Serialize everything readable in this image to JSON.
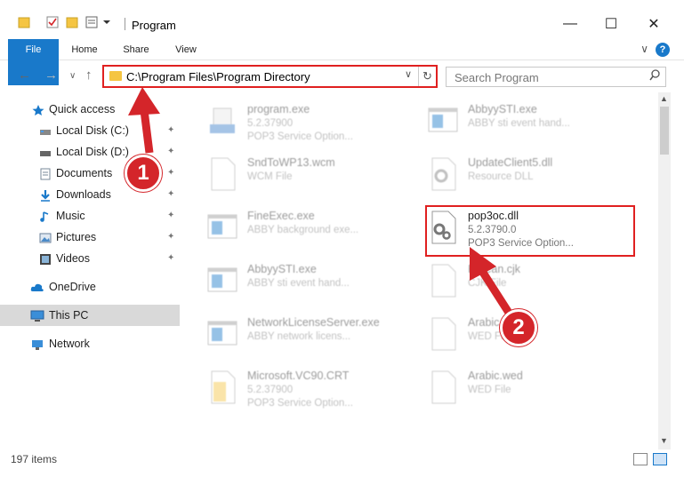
{
  "window": {
    "title": "Program",
    "minimize": "—",
    "maximize": "☐",
    "close": "✕"
  },
  "ribbon": {
    "tabs": [
      "File",
      "Home",
      "Share",
      "View"
    ],
    "help": "?",
    "collapse": "∨"
  },
  "address": {
    "path": "C:\\Program Files\\Program Directory",
    "dropdown": "∨",
    "refresh": "↻"
  },
  "search": {
    "placeholder": "Search Program",
    "icon": "search-icon"
  },
  "nav": {
    "back": "←",
    "forward": "→",
    "recent": "∨",
    "up": "↑"
  },
  "sidebar": {
    "items": [
      {
        "label": "Quick access",
        "icon": "star-icon",
        "pinned": false
      },
      {
        "label": "Local Disk (C:)",
        "icon": "drive-icon",
        "pinned": true
      },
      {
        "label": "Local Disk (D:)",
        "icon": "drive-icon",
        "pinned": true
      },
      {
        "label": "Documents",
        "icon": "documents-icon",
        "pinned": true
      },
      {
        "label": "Downloads",
        "icon": "download-icon",
        "pinned": true
      },
      {
        "label": "Music",
        "icon": "music-icon",
        "pinned": true
      },
      {
        "label": "Pictures",
        "icon": "pictures-icon",
        "pinned": true
      },
      {
        "label": "Videos",
        "icon": "videos-icon",
        "pinned": true
      },
      {
        "label": "OneDrive",
        "icon": "cloud-icon",
        "pinned": false
      },
      {
        "label": "This PC",
        "icon": "computer-icon",
        "pinned": false
      },
      {
        "label": "Network",
        "icon": "network-icon",
        "pinned": false
      }
    ],
    "pin_glyph": "📌"
  },
  "files": [
    {
      "name": "program.exe",
      "line2": "5.2.37900",
      "line3": "POP3 Service Option...",
      "icon": "setup-icon"
    },
    {
      "name": "AbbyySTI.exe",
      "line2": "ABBY sti event hand...",
      "line3": "",
      "icon": "app-window-icon"
    },
    {
      "name": "SndToWP13.wcm",
      "line2": "WCM File",
      "line3": "",
      "icon": "blank-file-icon"
    },
    {
      "name": "UpdateClient5.dll",
      "line2": "Resource DLL",
      "line3": "",
      "icon": "dll-gear-icon"
    },
    {
      "name": "FineExec.exe",
      "line2": "ABBY background exe...",
      "line3": "",
      "icon": "app-window-icon"
    },
    {
      "name": "pop3oc.dll",
      "line2": "5.2.3790.0",
      "line3": "POP3 Service Option...",
      "icon": "dll-gear-icon"
    },
    {
      "name": "AbbyySTI.exe",
      "line2": "ABBY sti event hand...",
      "line3": "",
      "icon": "app-window-icon"
    },
    {
      "name": "Korean.cjk",
      "line2": "CJK File",
      "line3": "",
      "icon": "blank-file-icon"
    },
    {
      "name": "NetworkLicenseServer.exe",
      "line2": "ABBY network licens...",
      "line3": "",
      "icon": "app-window-icon"
    },
    {
      "name": "Arabic.edc",
      "line2": "WED File",
      "line3": "",
      "icon": "blank-file-icon"
    },
    {
      "name": "Microsoft.VC90.CRT",
      "line2": "5.2.37900",
      "line3": "POP3 Service Option...",
      "icon": "folder-icon"
    },
    {
      "name": "Arabic.wed",
      "line2": "WED File",
      "line3": "",
      "icon": "blank-file-icon"
    }
  ],
  "status": {
    "count": "197 items"
  },
  "annotations": {
    "step1": "1",
    "step2": "2",
    "color": "#d4252a"
  },
  "colors": {
    "accent": "#1979ca",
    "highlight": "#e02020",
    "selection": "#d9d9d9"
  }
}
